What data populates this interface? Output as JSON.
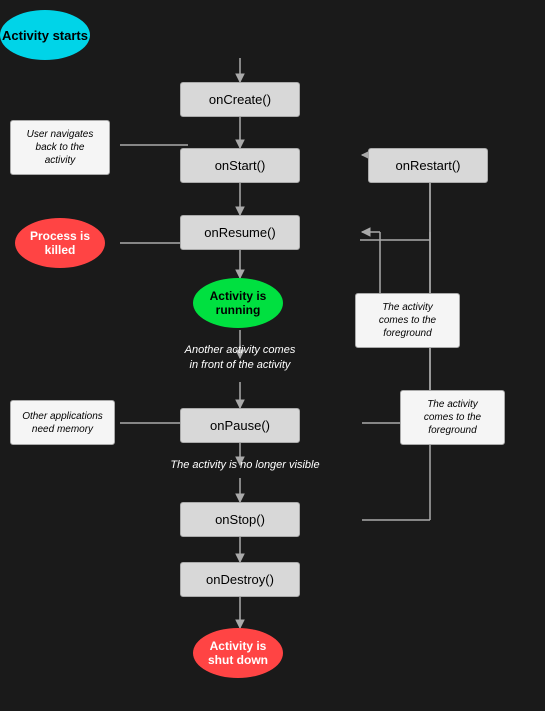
{
  "nodes": {
    "activity_starts": "Activity\nstarts",
    "on_create": "onCreate()",
    "on_start": "onStart()",
    "on_restart": "onRestart()",
    "on_resume": "onResume()",
    "activity_running": "Activity is\nrunning",
    "on_pause": "onPause()",
    "on_stop": "onStop()",
    "on_destroy": "onDestroy()",
    "activity_shutdown": "Activity is\nshut down"
  },
  "labels": {
    "user_navigates": "User navigates\nback to the\nactivity",
    "process_killed": "Process is\nkilled",
    "another_activity": "Another activity comes\nin front of the activity",
    "activity_foreground1": "The activity\ncomes to the\nforeground",
    "other_apps": "Other applications\nneed memory",
    "no_longer_visible": "The activity is no longer visible",
    "activity_foreground2": "The activity\ncomes to the\nforeground"
  }
}
